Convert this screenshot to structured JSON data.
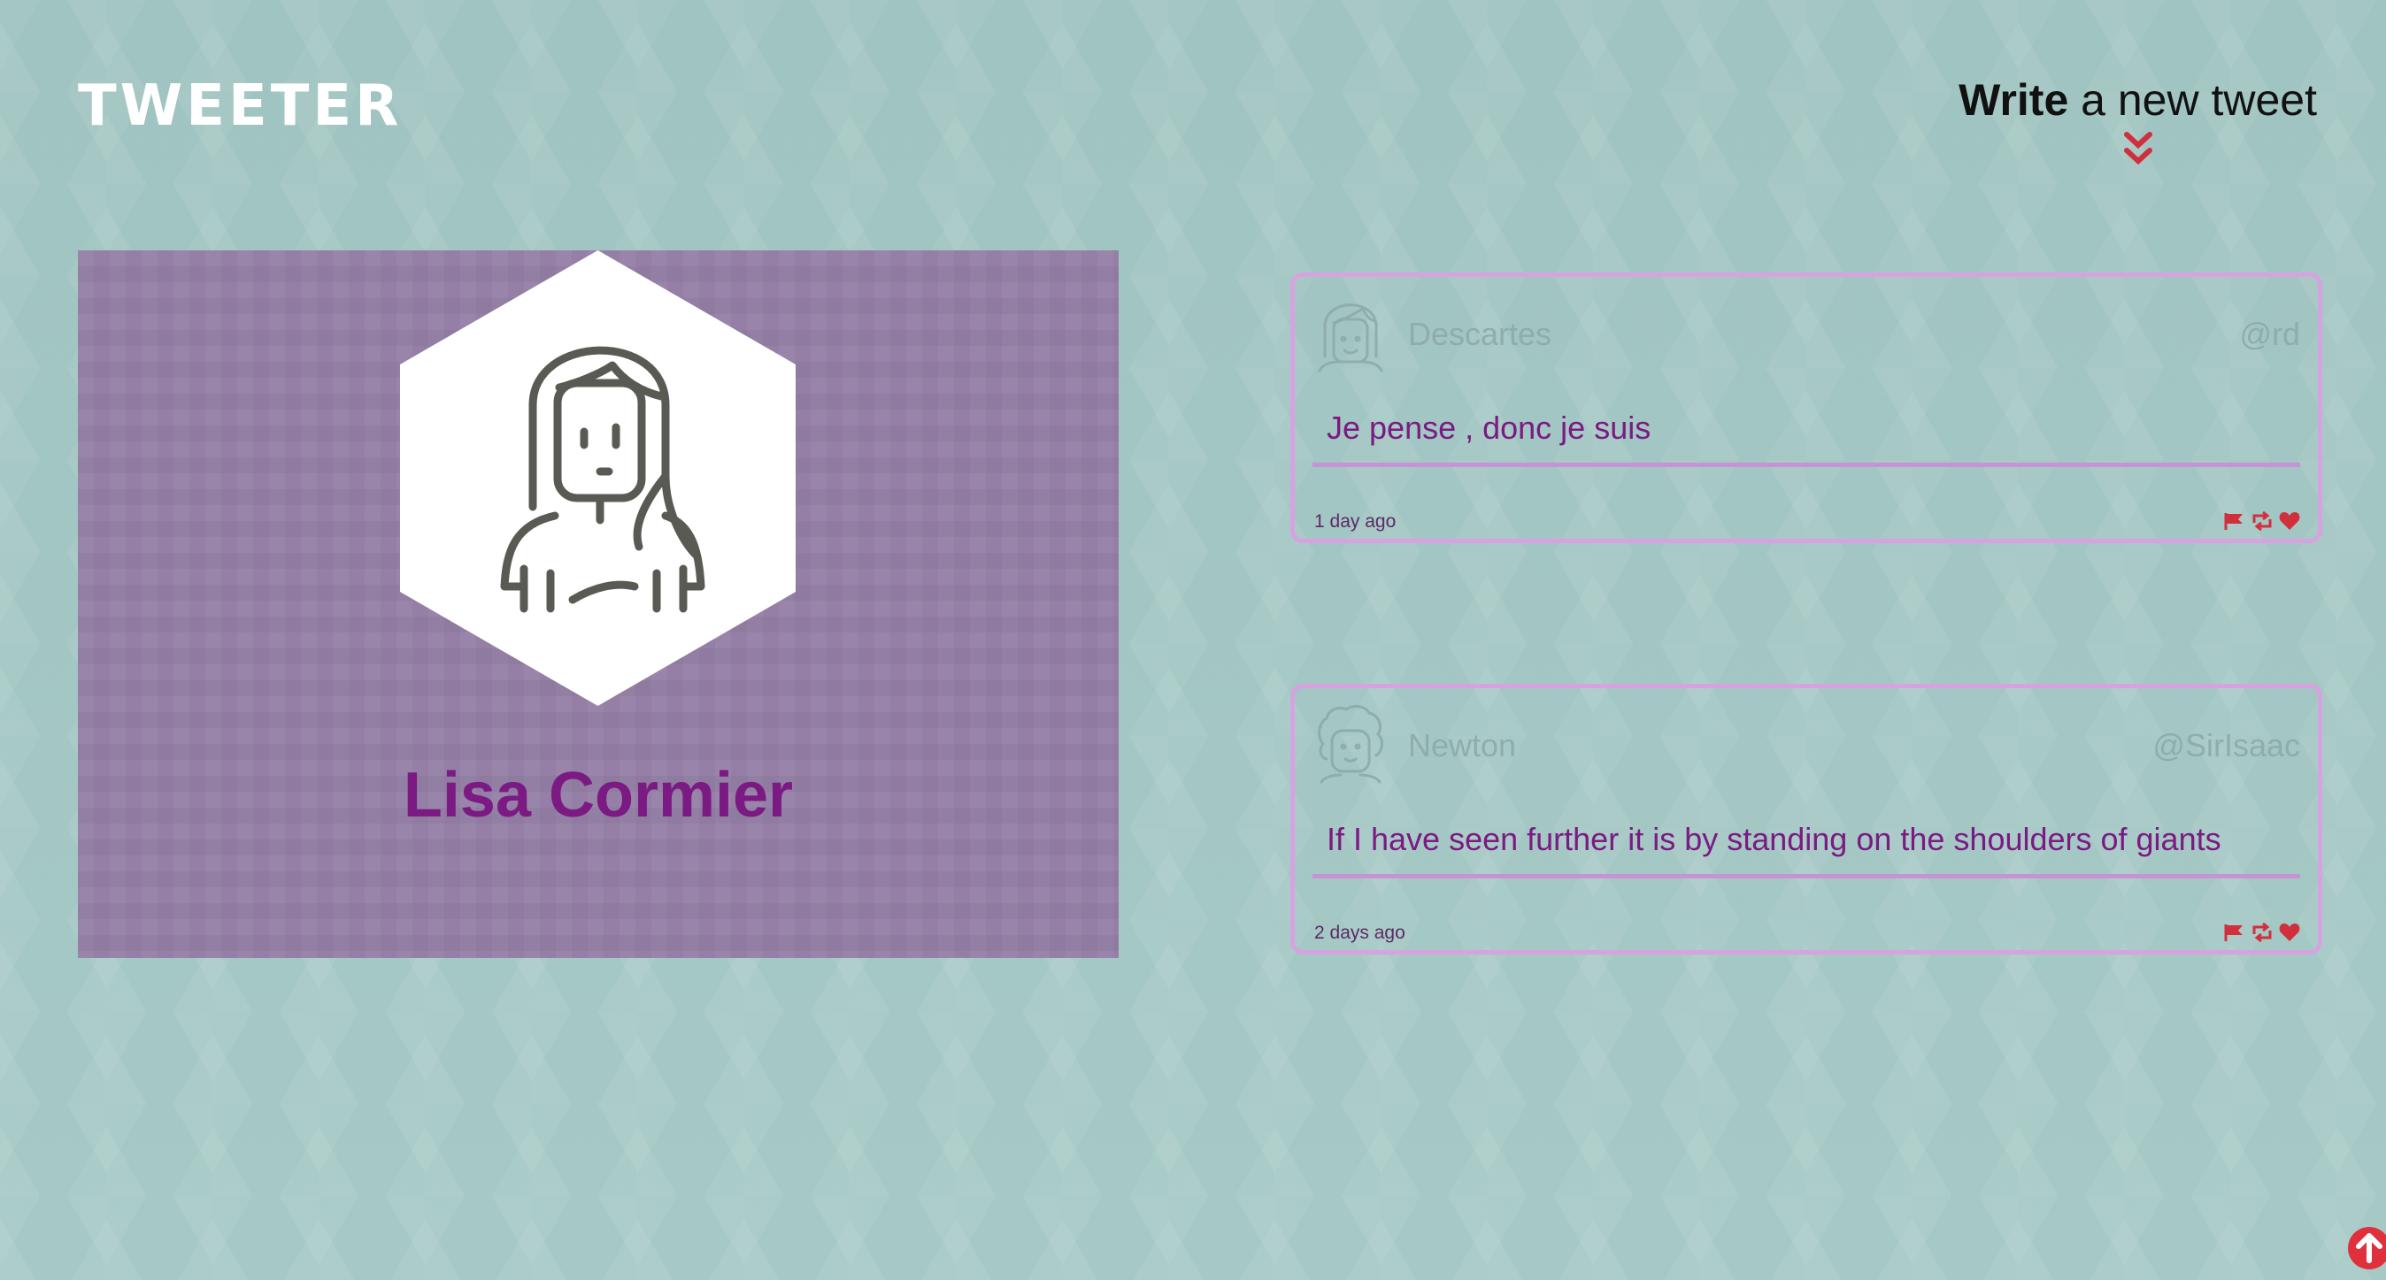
{
  "header": {
    "logo": "TWEETER",
    "compose_bold": "Write",
    "compose_rest": " a new tweet",
    "compose_icon": "double-chevron-down-icon"
  },
  "profile": {
    "name": "Lisa Cormier",
    "avatar_icon": "woman-avatar-icon"
  },
  "tweets": [
    {
      "author": "Descartes",
      "handle": "@rd",
      "text": "Je pense , donc je suis",
      "time": "1 day ago",
      "avatar_icon": "woman-avatar-icon"
    },
    {
      "author": "Newton",
      "handle": "@SirIsaac",
      "text": "If I have seen further it is by standing on the shoulders of giants",
      "time": "2 days ago",
      "avatar_icon": "curly-hair-man-avatar-icon"
    }
  ],
  "tweet_actions": [
    "flag-icon",
    "retweet-icon",
    "heart-icon"
  ],
  "scroll_top_icon": "arrow-up-circle-icon",
  "colors": {
    "background": "#9cc2bf",
    "profile_bg": "#957fa7",
    "accent_purple": "#7a1a82",
    "tweet_border": "#d7a2e0",
    "action_red": "#d0303c"
  }
}
